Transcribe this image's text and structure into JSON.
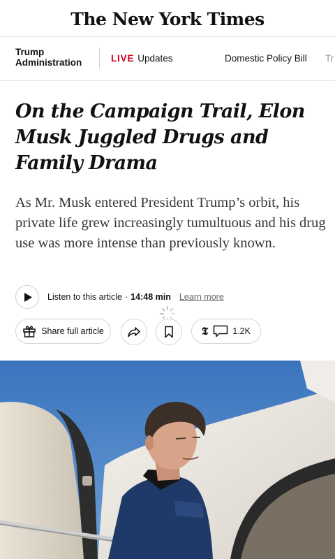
{
  "masthead": {
    "title": "The New York Times"
  },
  "nav": {
    "section": "Trump Administration",
    "live_tag": "LIVE",
    "live_label": "Updates",
    "links": [
      "Domestic Policy Bill",
      "Tr"
    ]
  },
  "article": {
    "headline": "On the Campaign Trail, Elon Musk Juggled Drugs and Family Drama",
    "summary": "As Mr. Musk entered President Trump’s orbit, his private life grew increasingly tumultuous and his drug use was more intense than previously known."
  },
  "audio": {
    "listen_label": "Listen to this article",
    "separator": "·",
    "duration": "14:48 min",
    "learn_more": "Learn more"
  },
  "actions": {
    "share_label": "Share full article",
    "logo_letter": "𝕿",
    "comment_count": "1.2K"
  },
  "colors": {
    "live_red": "#d0021b",
    "text": "#121212",
    "border": "#d5d5d5",
    "sky": "#3b78c2"
  },
  "icons": [
    "play-icon",
    "gift-icon",
    "forward-arrow-icon",
    "bookmark-icon",
    "nyt-logo-icon",
    "comment-icon",
    "loading-spinner-icon"
  ]
}
